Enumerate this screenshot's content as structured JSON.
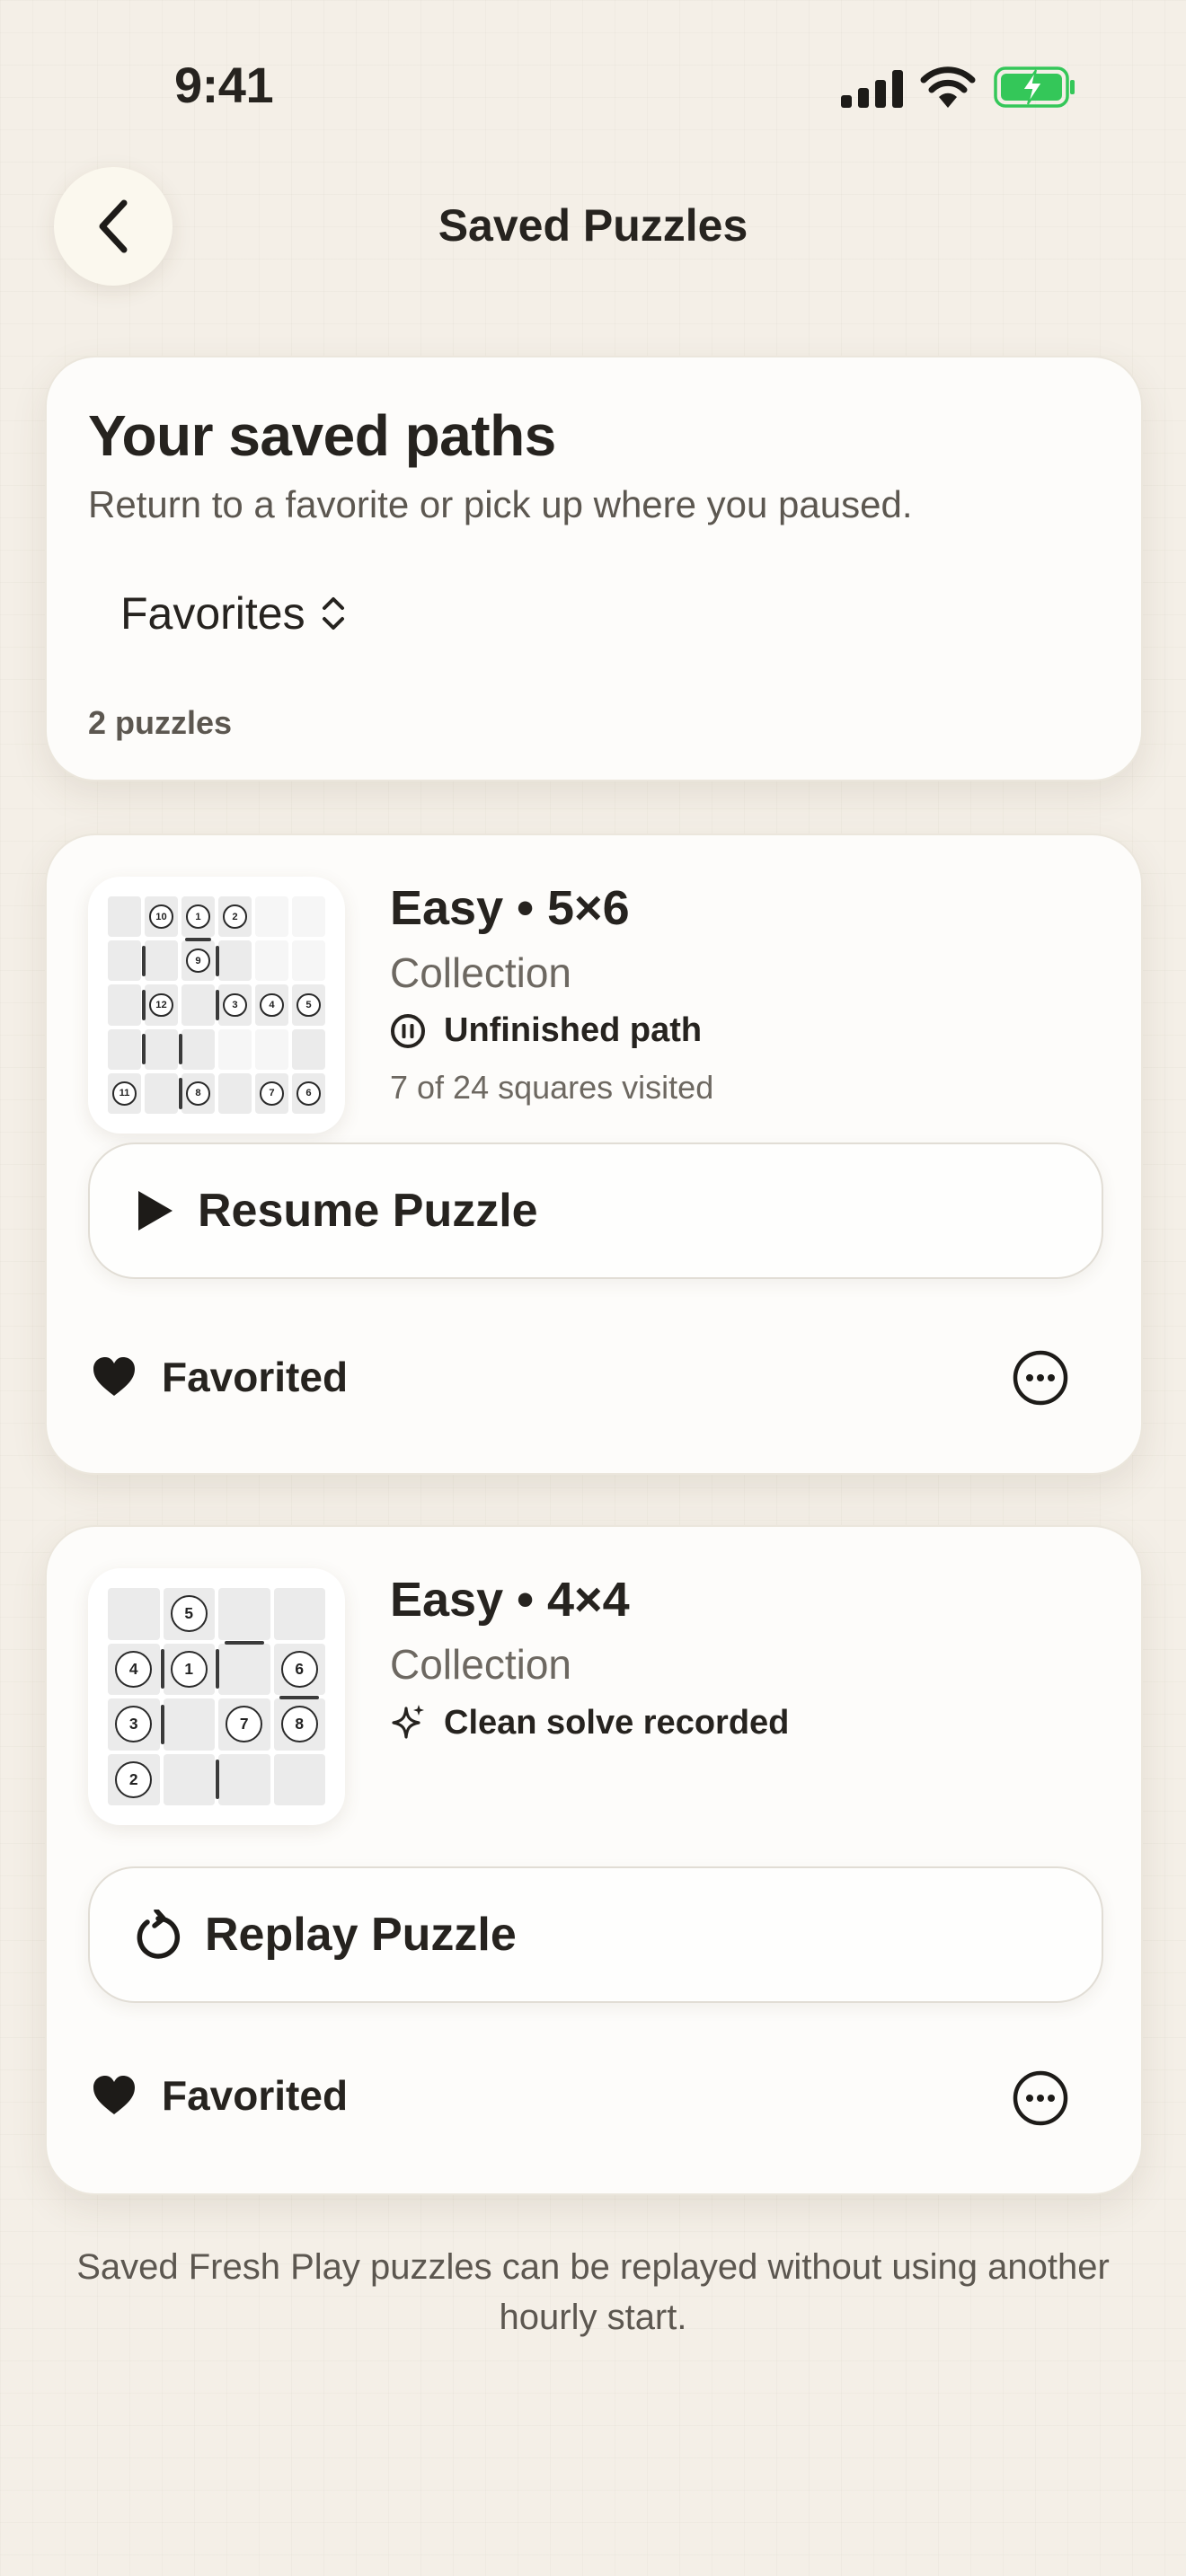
{
  "status_bar": {
    "time": "9:41"
  },
  "nav": {
    "title": "Saved Puzzles",
    "back_icon": "chevron-left-icon"
  },
  "header": {
    "title": "Your saved paths",
    "subtitle": "Return to a favorite or pick up where you paused.",
    "filter_label": "Favorites",
    "count": "2 puzzles"
  },
  "puzzles": [
    {
      "title": "Easy • 5×6",
      "collection": "Collection",
      "status": "Unfinished path",
      "status_icon": "pause-circle-icon",
      "progress": "7 of 24 squares visited",
      "action_label": "Resume Puzzle",
      "action_icon": "play-icon",
      "favorite_label": "Favorited",
      "grid": {
        "cols": 6,
        "rows": 5,
        "nodes": [
          {
            "c": 1,
            "r": 0,
            "n": "10"
          },
          {
            "c": 2,
            "r": 0,
            "n": "1"
          },
          {
            "c": 3,
            "r": 0,
            "n": "2"
          },
          {
            "c": 2,
            "r": 1,
            "n": "9"
          },
          {
            "c": 1,
            "r": 2,
            "n": "12"
          },
          {
            "c": 3,
            "r": 2,
            "n": "3"
          },
          {
            "c": 4,
            "r": 2,
            "n": "4"
          },
          {
            "c": 5,
            "r": 2,
            "n": "5"
          },
          {
            "c": 0,
            "r": 4,
            "n": "11"
          },
          {
            "c": 2,
            "r": 4,
            "n": "8"
          },
          {
            "c": 4,
            "r": 4,
            "n": "7"
          },
          {
            "c": 5,
            "r": 4,
            "n": "6"
          }
        ],
        "empty": [
          {
            "c": 4,
            "r": 0
          },
          {
            "c": 5,
            "r": 0
          },
          {
            "c": 4,
            "r": 1
          },
          {
            "c": 5,
            "r": 1
          },
          {
            "c": 3,
            "r": 3
          },
          {
            "c": 4,
            "r": 3
          }
        ]
      }
    },
    {
      "title": "Easy • 4×4",
      "collection": "Collection",
      "status": "Clean solve recorded",
      "status_icon": "sparkles-icon",
      "action_label": "Replay Puzzle",
      "action_icon": "replay-icon",
      "favorite_label": "Favorited",
      "grid": {
        "cols": 4,
        "rows": 4,
        "nodes": [
          {
            "c": 1,
            "r": 0,
            "n": "5"
          },
          {
            "c": 0,
            "r": 1,
            "n": "4"
          },
          {
            "c": 1,
            "r": 1,
            "n": "1"
          },
          {
            "c": 3,
            "r": 1,
            "n": "6"
          },
          {
            "c": 0,
            "r": 2,
            "n": "3"
          },
          {
            "c": 2,
            "r": 2,
            "n": "7"
          },
          {
            "c": 3,
            "r": 2,
            "n": "8"
          },
          {
            "c": 0,
            "r": 3,
            "n": "2"
          }
        ]
      }
    }
  ],
  "footer": "Saved Fresh Play puzzles can be replayed without using another hourly start.",
  "colors": {
    "battery": "#34c759",
    "background": "#f4efe7",
    "card": "#fdfcfa",
    "text": "#26231f"
  }
}
